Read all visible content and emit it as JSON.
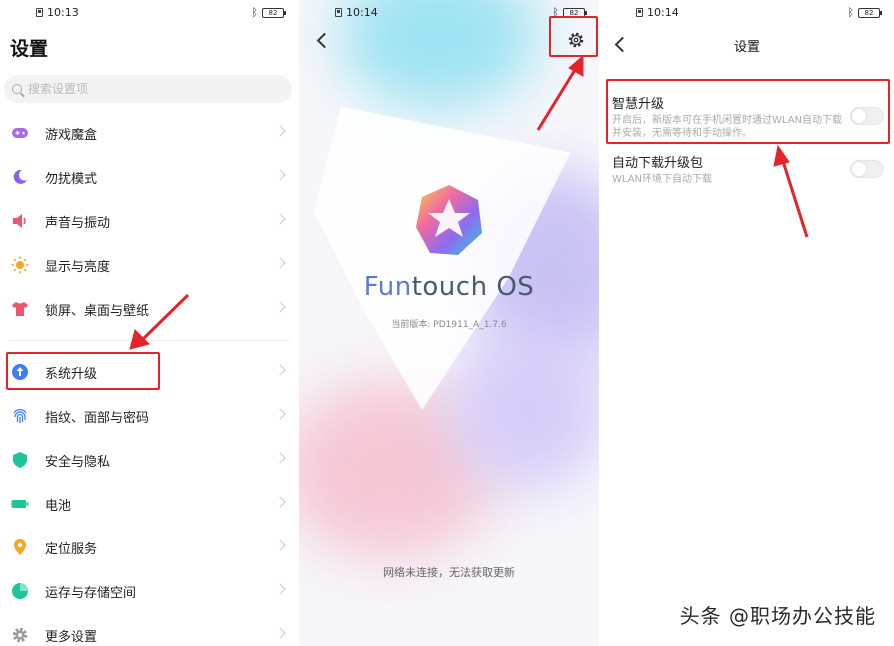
{
  "panel_settings": {
    "status_time": "10:13",
    "battery": "82",
    "title": "设置",
    "search_placeholder": "搜索设置项",
    "items": [
      {
        "label": "游戏魔盒",
        "icon": "gamepad-icon",
        "color": "#a66be8"
      },
      {
        "label": "勿扰模式",
        "icon": "moon-icon",
        "color": "#8b5cf6"
      },
      {
        "label": "声音与振动",
        "icon": "speaker-icon",
        "color": "#f0566b"
      },
      {
        "label": "显示与亮度",
        "icon": "sun-icon",
        "color": "#f5a623"
      },
      {
        "label": "锁屏、桌面与壁纸",
        "icon": "shirt-icon",
        "color": "#f0566b"
      },
      {
        "label": "系统升级",
        "icon": "upgrade-icon",
        "color": "#3d7df5"
      },
      {
        "label": "指纹、面部与密码",
        "icon": "fingerprint-icon",
        "color": "#3d7df5"
      },
      {
        "label": "安全与隐私",
        "icon": "shield-icon",
        "color": "#1ec59a"
      },
      {
        "label": "电池",
        "icon": "battery-icon",
        "color": "#1ec59a"
      },
      {
        "label": "定位服务",
        "icon": "location-icon",
        "color": "#f5a623"
      },
      {
        "label": "运存与存储空间",
        "icon": "storage-icon",
        "color": "#1ec59a"
      },
      {
        "label": "更多设置",
        "icon": "gear-icon",
        "color": "#9a9a9a"
      }
    ]
  },
  "panel_upgrade": {
    "status_time": "10:14",
    "battery": "82",
    "brand_fun": "Fun",
    "brand_rest": "touch OS",
    "version": "当前版本: PD1911_A_1.7.6",
    "network_status": "网络未连接，无法获取更新"
  },
  "panel_upgrade_settings": {
    "status_time": "10:14",
    "battery": "82",
    "title": "设置",
    "options": [
      {
        "title": "智慧升级",
        "desc": "开启后，新版本可在手机闲置时通过WLAN自动下载并安装，无需等待和手动操作。",
        "enabled": false
      },
      {
        "title": "自动下载升级包",
        "desc": "WLAN环境下自动下载",
        "enabled": false
      }
    ]
  },
  "watermark": "头条 @职场办公技能",
  "colors": {
    "highlight": "#e4232b",
    "accent": "#3d7df5"
  }
}
